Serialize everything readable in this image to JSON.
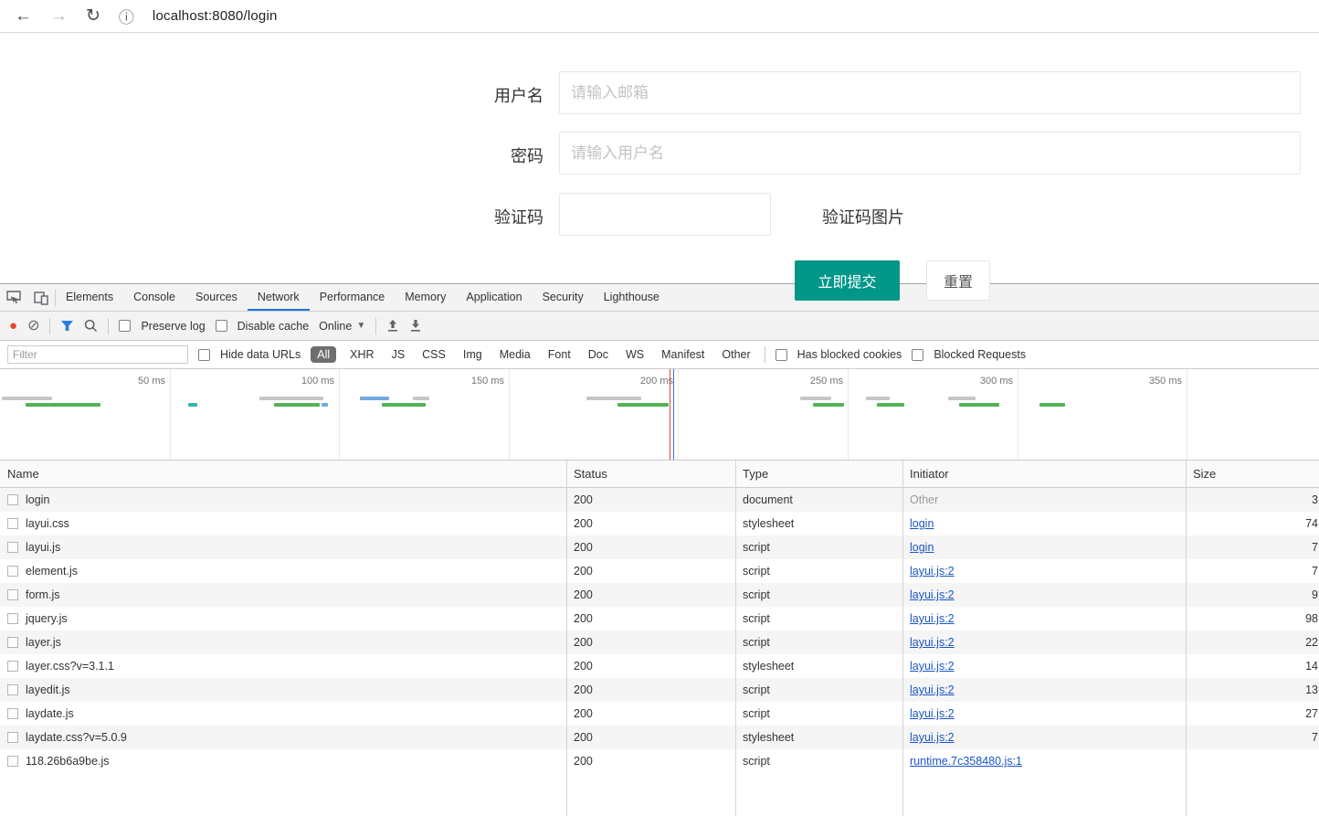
{
  "browser": {
    "url": "localhost:8080/login"
  },
  "icons": {
    "back": "←",
    "forward": "→",
    "reload": "↻",
    "info": "ⓘ",
    "record": "●",
    "clear": "⊘",
    "caret": "▼"
  },
  "colors": {
    "submit_green": "#009688",
    "active_tab_blue": "#1a73e8",
    "record_red": "#e8442e",
    "link_blue": "#1a56c4",
    "filter_pill_bg": "#6e6e6e",
    "bar_green": "#52b355"
  },
  "login": {
    "username_label": "用户名",
    "username_placeholder": "请输入邮箱",
    "password_label": "密码",
    "password_placeholder": "请输入用户名",
    "captcha_label": "验证码",
    "captcha_image_text": "验证码图片",
    "submit_button": "立即提交",
    "reset_button": "重置"
  },
  "devtools": {
    "tabs": [
      "Elements",
      "Console",
      "Sources",
      "Network",
      "Performance",
      "Memory",
      "Application",
      "Security",
      "Lighthouse"
    ],
    "active_tab": "Network",
    "toolbar": {
      "preserve_log": "Preserve log",
      "disable_cache": "Disable cache",
      "throttling": "Online"
    },
    "filter_bar": {
      "placeholder": "Filter",
      "hide_data_urls": "Hide data URLs",
      "types": [
        "All",
        "XHR",
        "JS",
        "CSS",
        "Img",
        "Media",
        "Font",
        "Doc",
        "WS",
        "Manifest",
        "Other"
      ],
      "active_type": "All",
      "has_blocked_cookies": "Has blocked cookies",
      "blocked_requests": "Blocked Requests"
    },
    "timeline": {
      "ticks": [
        "50 ms",
        "100 ms",
        "150 ms",
        "200 ms",
        "250 ms",
        "300 ms",
        "350 ms"
      ]
    },
    "network_table": {
      "columns": [
        "Name",
        "Status",
        "Type",
        "Initiator",
        "Size"
      ],
      "rows": [
        {
          "name": "login",
          "status": "200",
          "type": "document",
          "initiator": "Other",
          "size": "3"
        },
        {
          "name": "layui.css",
          "status": "200",
          "type": "stylesheet",
          "initiator": "login",
          "size": "74"
        },
        {
          "name": "layui.js",
          "status": "200",
          "type": "script",
          "initiator": "login",
          "size": "7"
        },
        {
          "name": "element.js",
          "status": "200",
          "type": "script",
          "initiator": "layui.js:2",
          "size": "7"
        },
        {
          "name": "form.js",
          "status": "200",
          "type": "script",
          "initiator": "layui.js:2",
          "size": "9"
        },
        {
          "name": "jquery.js",
          "status": "200",
          "type": "script",
          "initiator": "layui.js:2",
          "size": "98"
        },
        {
          "name": "layer.js",
          "status": "200",
          "type": "script",
          "initiator": "layui.js:2",
          "size": "22"
        },
        {
          "name": "layer.css?v=3.1.1",
          "status": "200",
          "type": "stylesheet",
          "initiator": "layui.js:2",
          "size": "14"
        },
        {
          "name": "layedit.js",
          "status": "200",
          "type": "script",
          "initiator": "layui.js:2",
          "size": "13"
        },
        {
          "name": "laydate.js",
          "status": "200",
          "type": "script",
          "initiator": "layui.js:2",
          "size": "27"
        },
        {
          "name": "laydate.css?v=5.0.9",
          "status": "200",
          "type": "stylesheet",
          "initiator": "layui.js:2",
          "size": "7"
        },
        {
          "name": "118.26b6a9be.js",
          "status": "200",
          "type": "script",
          "initiator": "runtime.7c358480.js:1",
          "size": ""
        }
      ]
    }
  }
}
